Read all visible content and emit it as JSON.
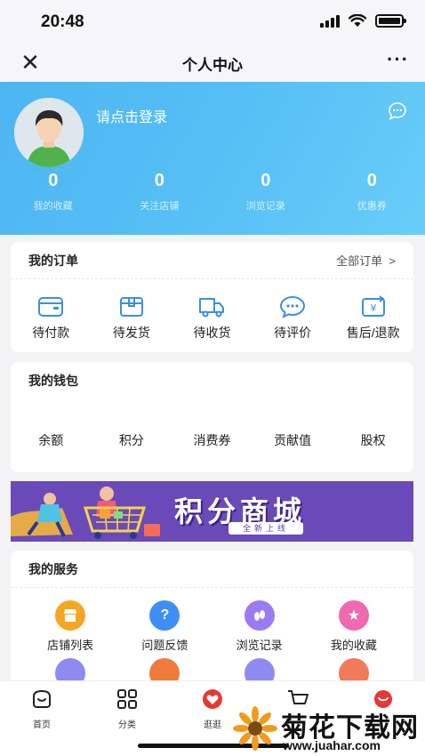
{
  "status_bar": {
    "time": "20:48"
  },
  "nav": {
    "title": "个人中心"
  },
  "profile": {
    "login_text": "请点击登录",
    "stats": [
      {
        "value": "0",
        "label": "我的收藏"
      },
      {
        "value": "0",
        "label": "关注店铺"
      },
      {
        "value": "0",
        "label": "浏览记录"
      },
      {
        "value": "0",
        "label": "优惠券"
      }
    ]
  },
  "orders": {
    "title": "我的订单",
    "all_label": "全部订单",
    "items": [
      {
        "label": "待付款",
        "icon": "wallet-icon"
      },
      {
        "label": "待发货",
        "icon": "box-icon"
      },
      {
        "label": "待收货",
        "icon": "truck-icon"
      },
      {
        "label": "待评价",
        "icon": "chat-icon"
      },
      {
        "label": "售后/退款",
        "icon": "refund-icon"
      }
    ]
  },
  "wallet": {
    "title": "我的钱包",
    "items": [
      "余额",
      "积分",
      "消费券",
      "贡献值",
      "股权"
    ]
  },
  "banner": {
    "title": "积分商城",
    "subtitle": "全新上线"
  },
  "services": {
    "title": "我的服务",
    "items": [
      {
        "label": "店铺列表",
        "icon": "store-icon",
        "color": "#f5a623"
      },
      {
        "label": "问题反馈",
        "icon": "question-icon",
        "color": "#3d8ff5"
      },
      {
        "label": "浏览记录",
        "icon": "footprint-icon",
        "color": "#9b7cf0"
      },
      {
        "label": "我的收藏",
        "icon": "star-icon",
        "color": "#f06ab0"
      }
    ],
    "row2_colors": [
      "#8f8af0",
      "#f07a3a",
      "#8f8af0",
      "#f07a5a"
    ]
  },
  "tabbar": {
    "items": [
      {
        "label": "首页",
        "icon": "home-icon"
      },
      {
        "label": "分类",
        "icon": "grid-icon"
      },
      {
        "label": "逛逛",
        "icon": "heart-icon"
      },
      {
        "label": "",
        "icon": "cart-icon"
      },
      {
        "label": "",
        "icon": "user-icon"
      }
    ]
  },
  "watermark": {
    "brand": "菊花下载网",
    "url": "www.juahar.com"
  },
  "colors": {
    "header_start": "#4db5f2",
    "header_end": "#68cdf8",
    "accent": "#3b8fe0",
    "banner_bg": "#6a4ab8"
  }
}
